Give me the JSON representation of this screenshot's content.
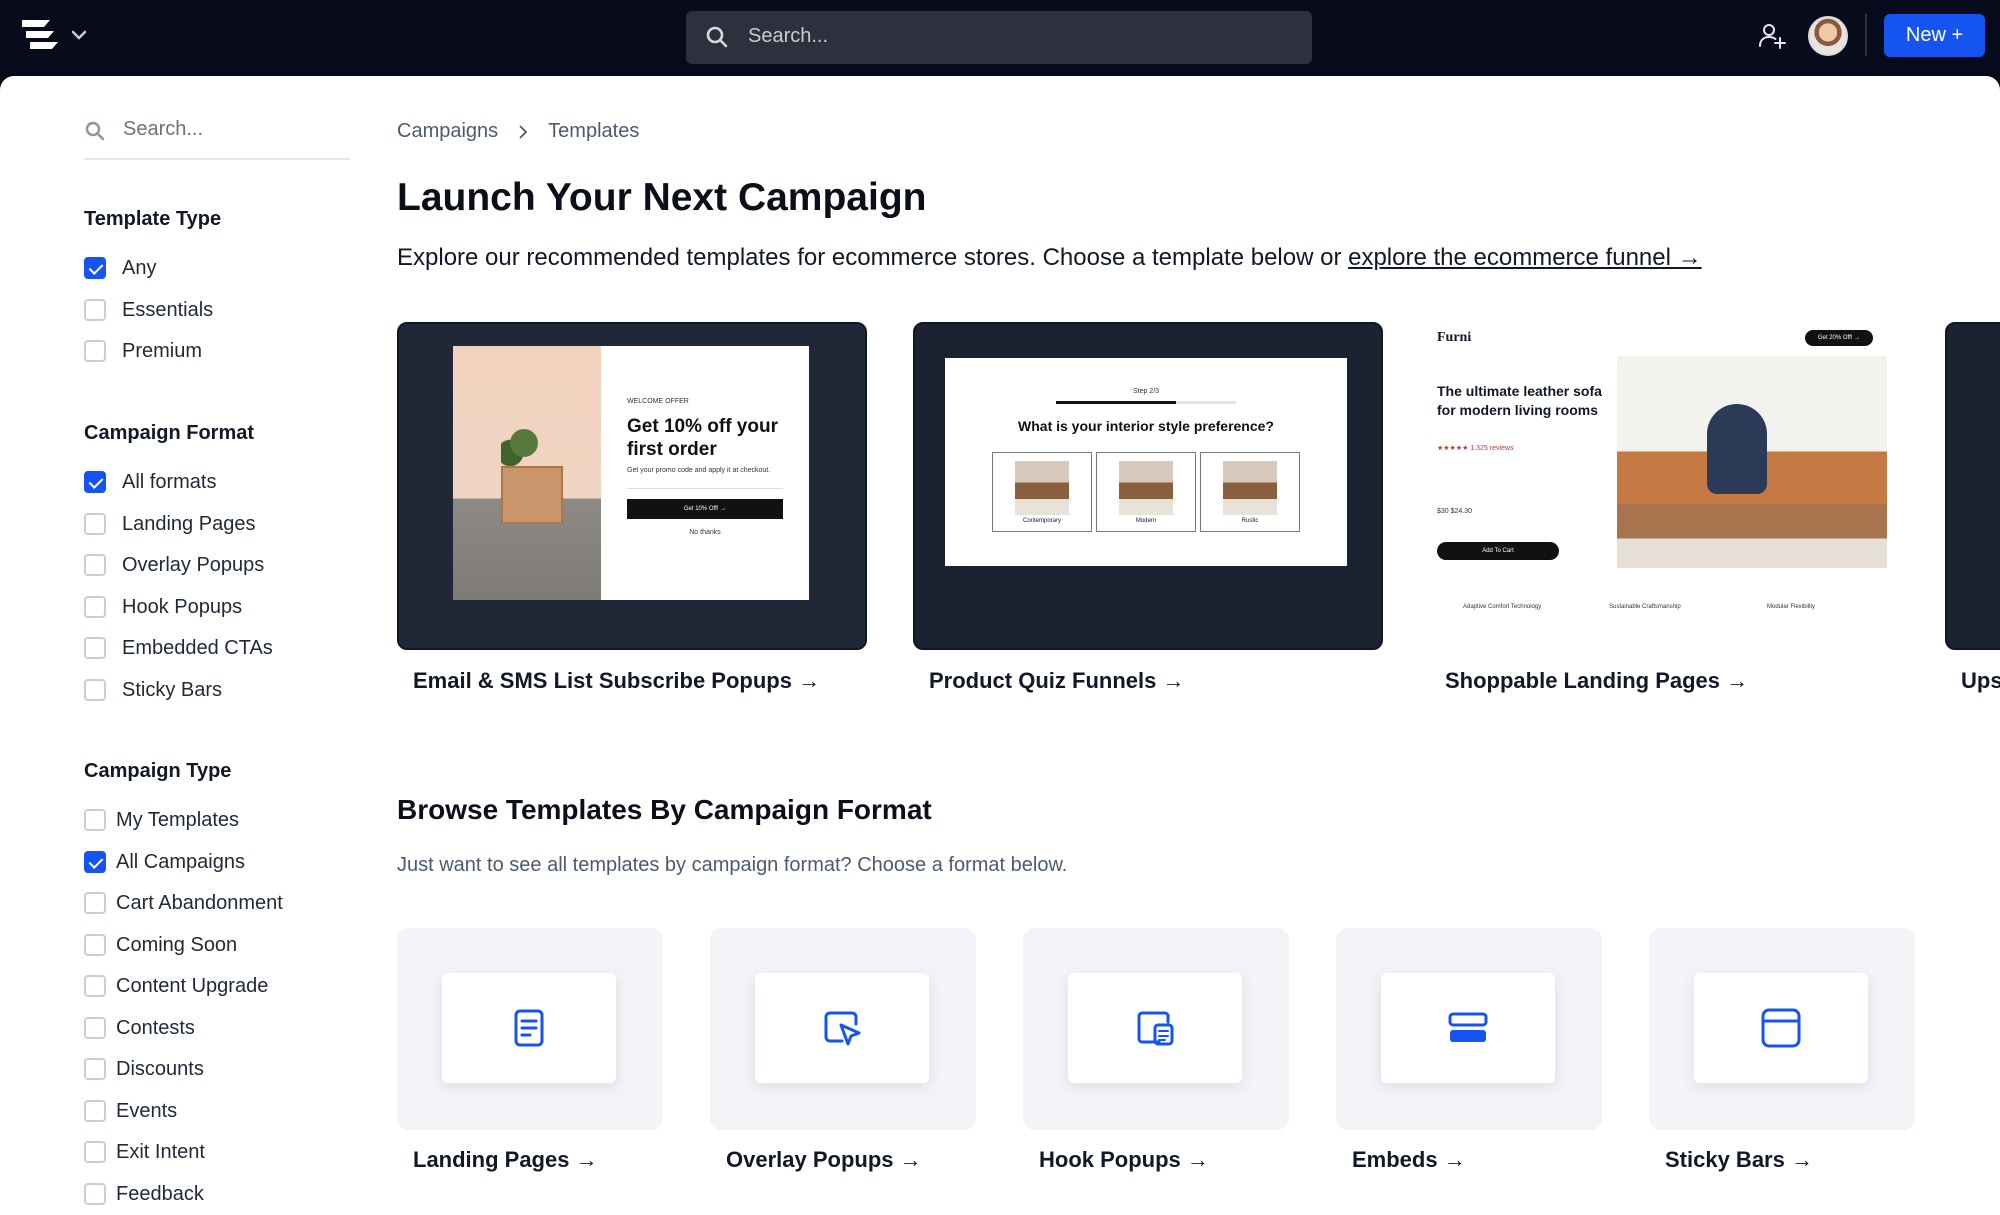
{
  "topbar": {
    "search_placeholder": "Search...",
    "new_label": "New +"
  },
  "sidebar": {
    "search_placeholder": "Search...",
    "groups": [
      {
        "title": "Template Type",
        "options": [
          {
            "label": "Any",
            "checked": true
          },
          {
            "label": "Essentials",
            "checked": false
          },
          {
            "label": "Premium",
            "checked": false
          }
        ]
      },
      {
        "title": "Campaign Format",
        "options": [
          {
            "label": "All formats",
            "checked": true
          },
          {
            "label": "Landing Pages",
            "checked": false
          },
          {
            "label": "Overlay Popups",
            "checked": false
          },
          {
            "label": "Hook Popups",
            "checked": false
          },
          {
            "label": "Embedded CTAs",
            "checked": false
          },
          {
            "label": "Sticky Bars",
            "checked": false
          }
        ]
      },
      {
        "title": "Campaign Type",
        "options": [
          {
            "label": "My Templates",
            "checked": false
          },
          {
            "label": "All Campaigns",
            "checked": true
          },
          {
            "label": "Cart Abandonment",
            "checked": false
          },
          {
            "label": "Coming Soon",
            "checked": false
          },
          {
            "label": "Content Upgrade",
            "checked": false
          },
          {
            "label": "Contests",
            "checked": false
          },
          {
            "label": "Discounts",
            "checked": false
          },
          {
            "label": "Events",
            "checked": false
          },
          {
            "label": "Exit Intent",
            "checked": false
          },
          {
            "label": "Feedback",
            "checked": false
          }
        ]
      }
    ]
  },
  "breadcrumb": [
    "Campaigns",
    "Templates"
  ],
  "main": {
    "title": "Launch Your Next Campaign",
    "lead_text": "Explore our recommended templates for ecommerce stores. Choose a template below or ",
    "lead_link": "explore the ecommerce funnel →",
    "featured": [
      {
        "label": "Email & SMS List Subscribe Popups →"
      },
      {
        "label": "Product Quiz Funnels →"
      },
      {
        "label": "Shoppable Landing Pages →"
      },
      {
        "label": "Ups"
      }
    ],
    "browse_title": "Browse Templates By Campaign Format",
    "browse_sub": "Just want to see all templates by campaign format? Choose a format below.",
    "formats": [
      {
        "label": "Landing Pages →",
        "icon": "document-icon"
      },
      {
        "label": "Overlay Popups →",
        "icon": "cursor-window-icon"
      },
      {
        "label": "Hook Popups →",
        "icon": "nested-window-icon"
      },
      {
        "label": "Embeds →",
        "icon": "embed-blocks-icon"
      },
      {
        "label": "Sticky Bars →",
        "icon": "browser-window-icon"
      }
    ]
  },
  "mock_email": {
    "eyebrow": "WELCOME OFFER",
    "headline": "Get 10% off your first order",
    "body": "Get your promo code and apply it at checkout.",
    "button": "Get 10% Off! →",
    "decline": "No thanks"
  },
  "mock_quiz": {
    "step": "Step 2/3",
    "question": "What is your interior style preference?",
    "options": [
      "Contemporary",
      "Modern",
      "Rustic"
    ]
  },
  "mock_landing": {
    "brand": "Furni",
    "pill": "Get 20% Off! →",
    "headline": "The ultimate leather sofa for modern living rooms",
    "reviews": "★★★★★ 1,325 reviews",
    "price": "$30 $24.30",
    "button": "Add To Cart",
    "features": [
      "Adaptive Comfort Technology",
      "Sustainable Craftsmanship",
      "Modular Flexibility"
    ]
  },
  "colors": {
    "accent": "#1554f0",
    "topbar_bg": "#070b1c",
    "card_dark": "#1b2231",
    "format_tile_bg": "#f2f4f8"
  }
}
